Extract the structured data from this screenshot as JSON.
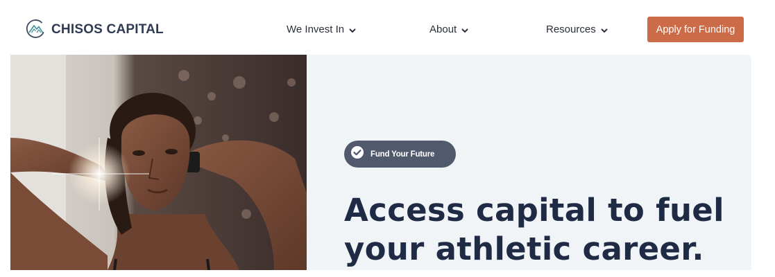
{
  "nav": {
    "brand": "CHISOS CAPITAL",
    "items": [
      {
        "label": "We Invest In"
      },
      {
        "label": "About"
      },
      {
        "label": "Resources"
      }
    ],
    "cta_label": "Apply for Funding"
  },
  "hero": {
    "badge": "Fund Your Future",
    "headline_line1": "Access capital to fuel",
    "headline_line2": "your athletic career."
  },
  "colors": {
    "accent": "#cc6b47",
    "badge_bg": "#505a6c",
    "panel_bg": "#f0f4f7",
    "heading": "#1f2a44"
  },
  "icons": {
    "logo": "mountain-circle-logo-icon",
    "dropdown": "chevron-down-icon",
    "badge": "check-circle-icon"
  }
}
